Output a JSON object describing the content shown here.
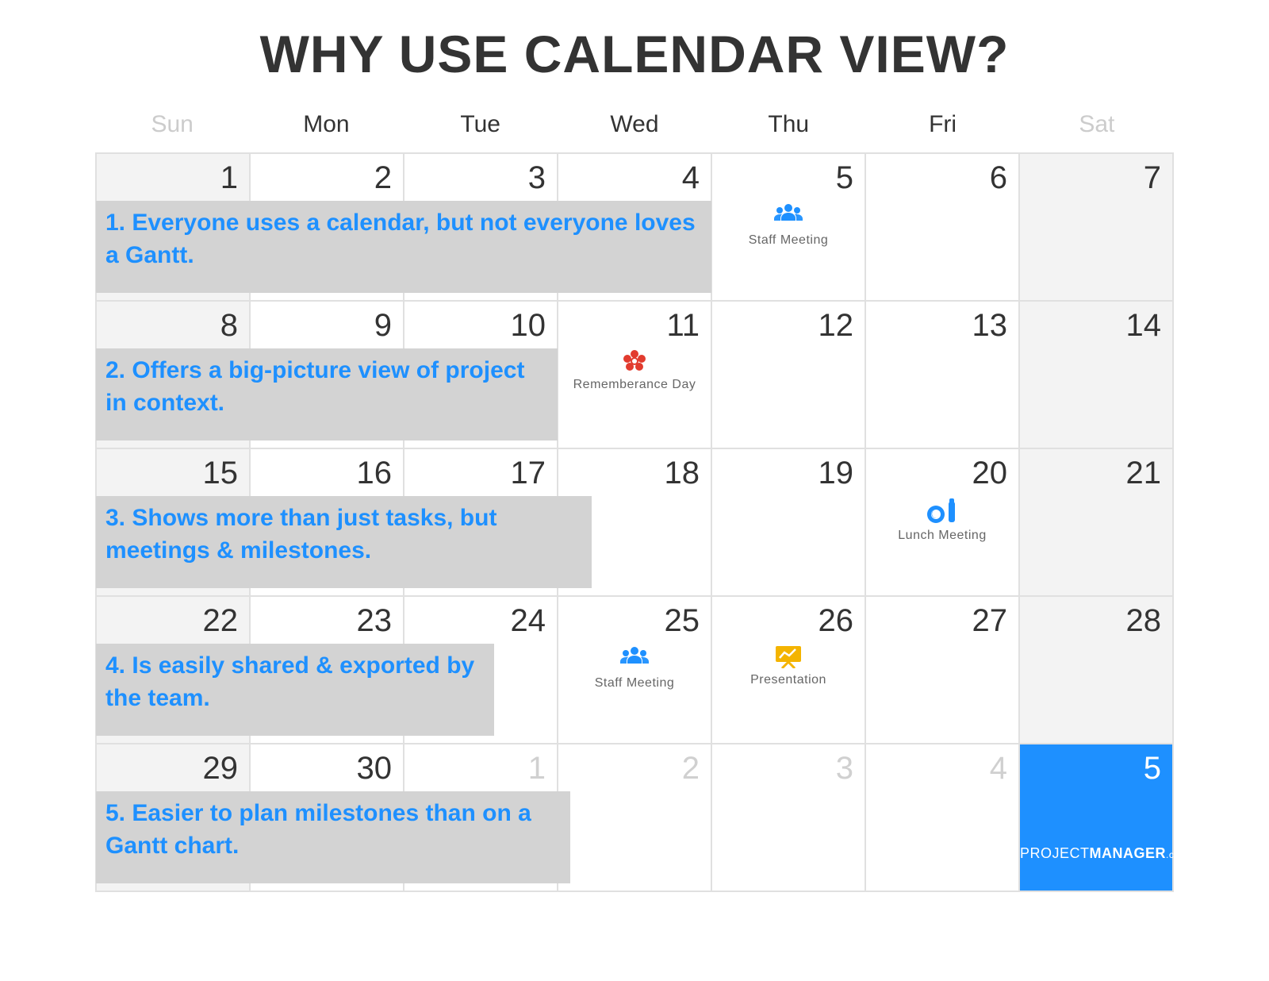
{
  "title": "WHY USE CALENDAR VIEW?",
  "weekdays": [
    "Sun",
    "Mon",
    "Tue",
    "Wed",
    "Thu",
    "Fri",
    "Sat"
  ],
  "days": [
    {
      "n": "1",
      "weekend": true
    },
    {
      "n": "2"
    },
    {
      "n": "3"
    },
    {
      "n": "4"
    },
    {
      "n": "5"
    },
    {
      "n": "6"
    },
    {
      "n": "7",
      "weekend": true
    },
    {
      "n": "8",
      "weekend": true
    },
    {
      "n": "9"
    },
    {
      "n": "10"
    },
    {
      "n": "11"
    },
    {
      "n": "12"
    },
    {
      "n": "13"
    },
    {
      "n": "14",
      "weekend": true
    },
    {
      "n": "15",
      "weekend": true
    },
    {
      "n": "16"
    },
    {
      "n": "17"
    },
    {
      "n": "18"
    },
    {
      "n": "19"
    },
    {
      "n": "20"
    },
    {
      "n": "21",
      "weekend": true
    },
    {
      "n": "22",
      "weekend": true
    },
    {
      "n": "23"
    },
    {
      "n": "24"
    },
    {
      "n": "25"
    },
    {
      "n": "26"
    },
    {
      "n": "27"
    },
    {
      "n": "28",
      "weekend": true
    },
    {
      "n": "29",
      "weekend": true
    },
    {
      "n": "30"
    },
    {
      "n": "1",
      "faded": true
    },
    {
      "n": "2",
      "faded": true
    },
    {
      "n": "3",
      "faded": true
    },
    {
      "n": "4",
      "faded": true
    },
    {
      "n": "5",
      "highlight": true
    }
  ],
  "events": {
    "staff_meeting_5": "Staff Meeting",
    "remembrance_11": "Rememberance Day",
    "lunch_meeting_20": "Lunch Meeting",
    "staff_meeting_25": "Staff Meeting",
    "presentation_26": "Presentation"
  },
  "annotations": {
    "a1": "1. Everyone uses a calendar, but not everyone loves a Gantt.",
    "a2": "2. Offers a big-picture view of project in context.",
    "a3": "3. Shows more than just tasks, but meetings & milestones.",
    "a4": "4. Is easily shared & exported by the team.",
    "a5": "5. Easier to plan milestones than on a Gantt chart."
  },
  "logo": {
    "p1": "PROJECT",
    "p2": "MANAGER",
    "p3": ".com"
  }
}
